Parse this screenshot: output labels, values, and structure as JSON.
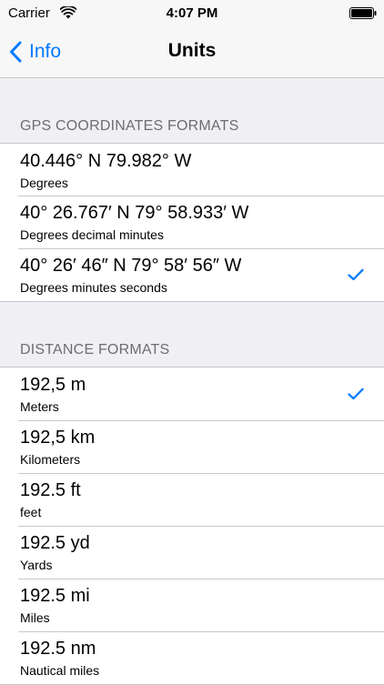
{
  "status_bar": {
    "carrier": "Carrier",
    "time": "4:07 PM",
    "icons": [
      "wifi-icon",
      "battery-icon"
    ]
  },
  "nav": {
    "back_label": "Info",
    "title": "Units",
    "back_icon": "chevron-left-icon"
  },
  "colors": {
    "accent": "#007aff",
    "background": "#efeff4",
    "separator": "#c8c7cc",
    "section_header_text": "#6d6d72"
  },
  "sections": [
    {
      "header": "GPS COORDINATES FORMATS",
      "items": [
        {
          "title": "40.446° N 79.982° W",
          "subtitle": "Degrees",
          "selected": false
        },
        {
          "title": "40° 26.767′ N 79° 58.933′ W",
          "subtitle": "Degrees decimal minutes",
          "selected": false
        },
        {
          "title": "40° 26′ 46″ N 79° 58′ 56″ W",
          "subtitle": "Degrees minutes seconds",
          "selected": true
        }
      ]
    },
    {
      "header": "DISTANCE FORMATS",
      "items": [
        {
          "title": "192,5 m",
          "subtitle": "Meters",
          "selected": true
        },
        {
          "title": "192,5 km",
          "subtitle": "Kilometers",
          "selected": false
        },
        {
          "title": "192.5 ft",
          "subtitle": "feet",
          "selected": false
        },
        {
          "title": "192.5 yd",
          "subtitle": "Yards",
          "selected": false
        },
        {
          "title": "192.5 mi",
          "subtitle": "Miles",
          "selected": false
        },
        {
          "title": "192.5 nm",
          "subtitle": "Nautical miles",
          "selected": false
        }
      ]
    }
  ]
}
